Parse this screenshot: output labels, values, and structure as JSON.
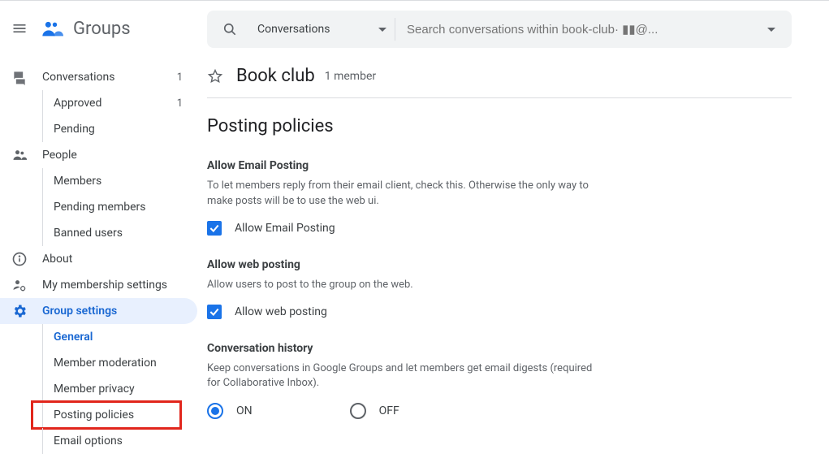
{
  "brand": {
    "name": "Groups"
  },
  "sidebar": {
    "conversations": {
      "label": "Conversations",
      "count": "1"
    },
    "approved": {
      "label": "Approved",
      "count": "1"
    },
    "pending": {
      "label": "Pending"
    },
    "people": {
      "label": "People"
    },
    "members": {
      "label": "Members"
    },
    "pending_members": {
      "label": "Pending members"
    },
    "banned": {
      "label": "Banned users"
    },
    "about": {
      "label": "About"
    },
    "my_membership": {
      "label": "My membership settings"
    },
    "group_settings": {
      "label": "Group settings"
    },
    "general": {
      "label": "General"
    },
    "member_moderation": {
      "label": "Member moderation"
    },
    "member_privacy": {
      "label": "Member privacy"
    },
    "posting_policies": {
      "label": "Posting policies"
    },
    "email_options": {
      "label": "Email options"
    }
  },
  "search": {
    "scope": "Conversations",
    "placeholder": "Search conversations within book-club· ▮▮@..."
  },
  "header": {
    "group_name": "Book club",
    "members": "1 member"
  },
  "page": {
    "title": "Posting policies"
  },
  "sections": {
    "email_posting": {
      "title": "Allow Email Posting",
      "desc": "To let members reply from their email client, check this. Otherwise the only way to make posts will be to use the web ui.",
      "checkbox_label": "Allow Email Posting",
      "checked": true
    },
    "web_posting": {
      "title": "Allow web posting",
      "desc": "Allow users to post to the group on the web.",
      "checkbox_label": "Allow web posting",
      "checked": true
    },
    "conversation_history": {
      "title": "Conversation history",
      "desc": "Keep conversations in Google Groups and let members get email digests (required for Collaborative Inbox).",
      "on_label": "ON",
      "off_label": "OFF",
      "value": "ON"
    }
  }
}
